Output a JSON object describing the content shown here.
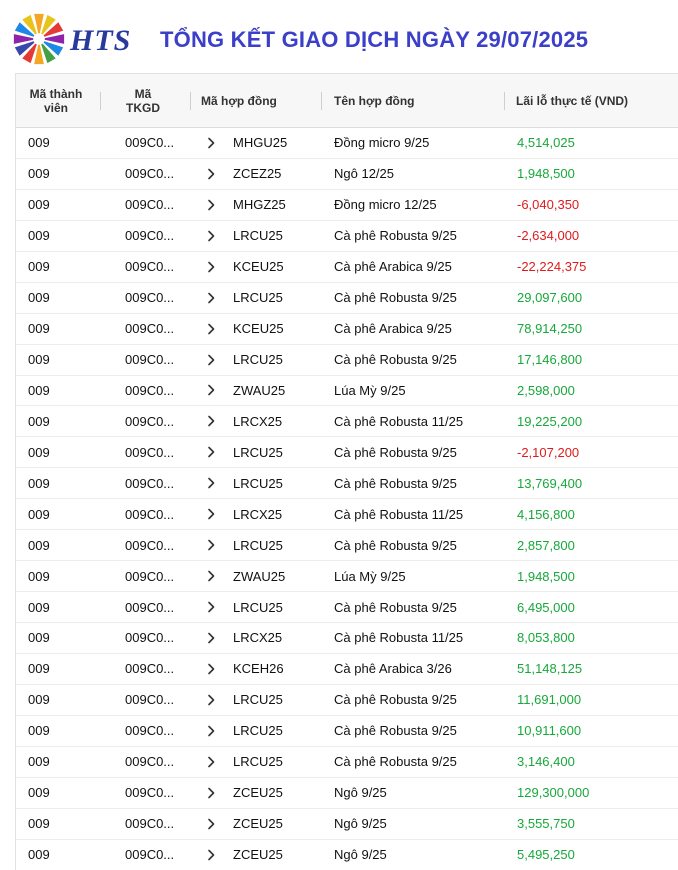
{
  "header": {
    "brand": "HTS",
    "title": "TỔNG KẾT GIAO DỊCH NGÀY 29/07/2025",
    "logo_icon": "hts-sunburst-logo"
  },
  "colors": {
    "title": "#3c3fc7",
    "brand": "#2a3a9c",
    "positive": "#17a83a",
    "negative": "#e01b1b"
  },
  "table": {
    "columns": {
      "member": "Mã thành viên",
      "account": "Mã TKGD",
      "contract_code": "Mã hợp đồng",
      "contract_name": "Tên hợp đồng",
      "pnl": "Lãi lỗ thực tế (VND)"
    },
    "rows": [
      {
        "member": "009",
        "account": "009C0...",
        "code": "MHGU25",
        "name": "Đồng micro 9/25",
        "pnl": "4,514,025",
        "sign": "pos"
      },
      {
        "member": "009",
        "account": "009C0...",
        "code": "ZCEZ25",
        "name": "Ngô 12/25",
        "pnl": "1,948,500",
        "sign": "pos"
      },
      {
        "member": "009",
        "account": "009C0...",
        "code": "MHGZ25",
        "name": "Đồng micro 12/25",
        "pnl": "-6,040,350",
        "sign": "neg"
      },
      {
        "member": "009",
        "account": "009C0...",
        "code": "LRCU25",
        "name": "Cà phê Robusta 9/25",
        "pnl": "-2,634,000",
        "sign": "neg"
      },
      {
        "member": "009",
        "account": "009C0...",
        "code": "KCEU25",
        "name": "Cà phê Arabica 9/25",
        "pnl": "-22,224,375",
        "sign": "neg"
      },
      {
        "member": "009",
        "account": "009C0...",
        "code": "LRCU25",
        "name": "Cà phê Robusta 9/25",
        "pnl": "29,097,600",
        "sign": "pos"
      },
      {
        "member": "009",
        "account": "009C0...",
        "code": "KCEU25",
        "name": "Cà phê Arabica 9/25",
        "pnl": "78,914,250",
        "sign": "pos"
      },
      {
        "member": "009",
        "account": "009C0...",
        "code": "LRCU25",
        "name": "Cà phê Robusta 9/25",
        "pnl": "17,146,800",
        "sign": "pos"
      },
      {
        "member": "009",
        "account": "009C0...",
        "code": "ZWAU25",
        "name": "Lúa Mỳ 9/25",
        "pnl": "2,598,000",
        "sign": "pos"
      },
      {
        "member": "009",
        "account": "009C0...",
        "code": "LRCX25",
        "name": "Cà phê Robusta 11/25",
        "pnl": "19,225,200",
        "sign": "pos"
      },
      {
        "member": "009",
        "account": "009C0...",
        "code": "LRCU25",
        "name": "Cà phê Robusta 9/25",
        "pnl": "-2,107,200",
        "sign": "neg"
      },
      {
        "member": "009",
        "account": "009C0...",
        "code": "LRCU25",
        "name": "Cà phê Robusta 9/25",
        "pnl": "13,769,400",
        "sign": "pos"
      },
      {
        "member": "009",
        "account": "009C0...",
        "code": "LRCX25",
        "name": "Cà phê Robusta 11/25",
        "pnl": "4,156,800",
        "sign": "pos"
      },
      {
        "member": "009",
        "account": "009C0...",
        "code": "LRCU25",
        "name": "Cà phê Robusta 9/25",
        "pnl": "2,857,800",
        "sign": "pos"
      },
      {
        "member": "009",
        "account": "009C0...",
        "code": "ZWAU25",
        "name": "Lúa Mỳ 9/25",
        "pnl": "1,948,500",
        "sign": "pos"
      },
      {
        "member": "009",
        "account": "009C0...",
        "code": "LRCU25",
        "name": "Cà phê Robusta 9/25",
        "pnl": "6,495,000",
        "sign": "pos"
      },
      {
        "member": "009",
        "account": "009C0...",
        "code": "LRCX25",
        "name": "Cà phê Robusta 11/25",
        "pnl": "8,053,800",
        "sign": "pos"
      },
      {
        "member": "009",
        "account": "009C0...",
        "code": "KCEH26",
        "name": "Cà phê Arabica 3/26",
        "pnl": "51,148,125",
        "sign": "pos"
      },
      {
        "member": "009",
        "account": "009C0...",
        "code": "LRCU25",
        "name": "Cà phê Robusta 9/25",
        "pnl": "11,691,000",
        "sign": "pos"
      },
      {
        "member": "009",
        "account": "009C0...",
        "code": "LRCU25",
        "name": "Cà phê Robusta 9/25",
        "pnl": "10,911,600",
        "sign": "pos"
      },
      {
        "member": "009",
        "account": "009C0...",
        "code": "LRCU25",
        "name": "Cà phê Robusta 9/25",
        "pnl": "3,146,400",
        "sign": "pos"
      },
      {
        "member": "009",
        "account": "009C0...",
        "code": "ZCEU25",
        "name": "Ngô 9/25",
        "pnl": "129,300,000",
        "sign": "pos"
      },
      {
        "member": "009",
        "account": "009C0...",
        "code": "ZCEU25",
        "name": "Ngô 9/25",
        "pnl": "3,555,750",
        "sign": "pos"
      },
      {
        "member": "009",
        "account": "009C0...",
        "code": "ZCEU25",
        "name": "Ngô 9/25",
        "pnl": "5,495,250",
        "sign": "pos"
      }
    ]
  }
}
